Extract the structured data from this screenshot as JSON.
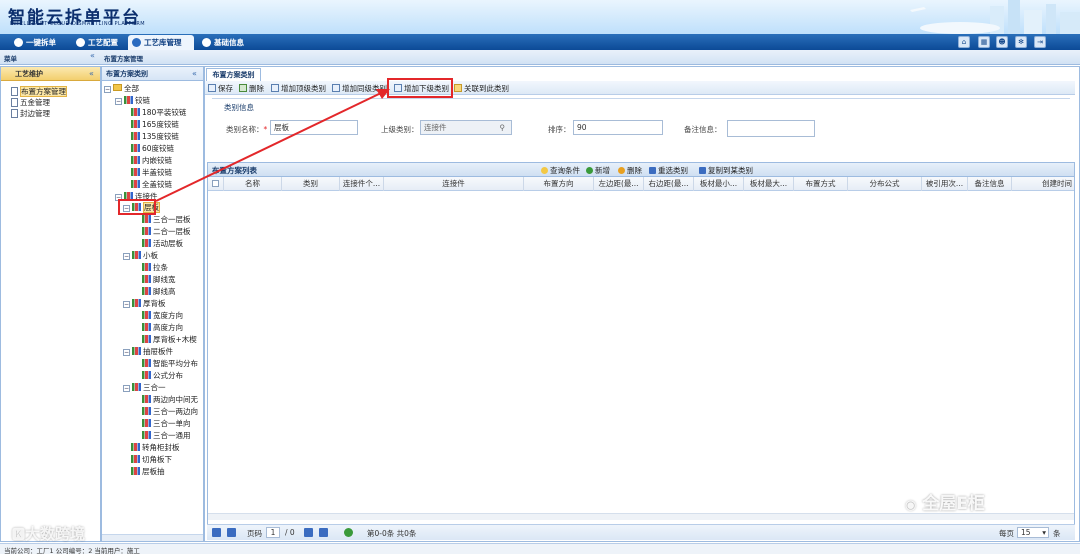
{
  "app": {
    "title": "智能云拆单平台",
    "subtitle": "INTELLIGENT CLOUD DISMANTLING PLATFORM"
  },
  "nav": {
    "tabs": [
      {
        "label": "一键拆单",
        "active": false
      },
      {
        "label": "工艺配置",
        "active": false
      },
      {
        "label": "工艺库管理",
        "active": true
      },
      {
        "label": "基础信息",
        "active": false
      }
    ],
    "icons": [
      "home-icon",
      "calendar-icon",
      "user-icon",
      "gear-icon",
      "exit-icon"
    ]
  },
  "strip": {
    "left": "菜单",
    "middle": "布置方案管理"
  },
  "menu": {
    "header": "工艺维护",
    "items": [
      "布置方案管理",
      "五金管理",
      "封边管理"
    ]
  },
  "tree": {
    "header": "布置方案类别",
    "nodes": [
      "全部",
      "铰链",
      "180平装铰链",
      "165度铰链",
      "135度铰链",
      "60度铰链",
      "内嵌铰链",
      "半盖铰链",
      "全盖铰链",
      "连接件",
      "层板",
      "三合一层板",
      "二合一层板",
      "活动层板",
      "小板",
      "拉条",
      "脚线宽",
      "脚线高",
      "厚背板",
      "宽度方向",
      "高度方向",
      "厚背板+木楔",
      "抽屉板件",
      "智能平均分布",
      "公式分布",
      "三合一",
      "两边向中间无",
      "三合一两边向",
      "三合一单向",
      "三合一通用",
      "转角柜封板",
      "切角板下",
      "层板抽"
    ]
  },
  "content": {
    "tab": "布置方案类别",
    "toolbar": [
      "保存",
      "删除",
      "增加顶级类别",
      "增加同级类别",
      "增加下级类别",
      "关联到此类别"
    ],
    "form": {
      "legend": "类别信息",
      "name_label": "类别名称：",
      "required": "*",
      "name_value": "层板",
      "parent_label": "上级类别：",
      "parent_value": "连接件",
      "order_label": "排序：",
      "order_value": "90",
      "remark_label": "备注信息："
    },
    "grid": {
      "title": "布置方案列表",
      "actions": [
        "查询条件",
        "新增",
        "删除",
        "重选类别",
        "复制到某类别"
      ],
      "columns": [
        "名称",
        "类别",
        "连接件个...",
        "连接件",
        "布置方向",
        "左边距(最...",
        "右边距(最...",
        "板材最小...",
        "板材最大...",
        "布置方式",
        "分布公式",
        "被引用次...",
        "备注信息",
        "创建时间"
      ]
    },
    "pager": {
      "page_label": "页码",
      "page_value": "1",
      "of": "/ 0",
      "records": "第0-0条  共0条",
      "per_page_label": "每页",
      "per_page_value": "15",
      "unit": "条"
    }
  },
  "status": "当前公司：工厂1    公司编号：2    当前用户：施工",
  "watermarks": [
    "大数跨境",
    "全屋E柜"
  ]
}
